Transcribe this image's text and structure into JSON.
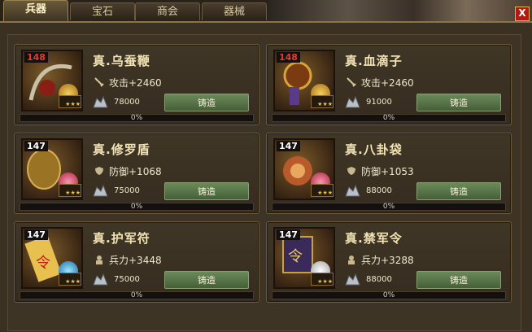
{
  "tabs": [
    {
      "label": "兵器",
      "active": true
    },
    {
      "label": "宝石",
      "active": false
    },
    {
      "label": "商会",
      "active": false
    },
    {
      "label": "器械",
      "active": false
    }
  ],
  "close_label": "X",
  "items": [
    {
      "level": "148",
      "name": "真.乌蚕鞭",
      "stat": "攻击+2460",
      "stat_icon": "sword-icon",
      "cost": "78000",
      "forge_label": "铸造",
      "progress": "0%",
      "level_color": "#e83a2a",
      "gem_color": "#d8a020"
    },
    {
      "level": "148",
      "name": "真.血滴子",
      "stat": "攻击+2460",
      "stat_icon": "sword-icon",
      "cost": "91000",
      "forge_label": "铸造",
      "progress": "0%",
      "level_color": "#e83a2a",
      "gem_color": "#d8a020"
    },
    {
      "level": "147",
      "name": "真.修罗盾",
      "stat": "防御+1068",
      "stat_icon": "shield-icon",
      "cost": "75000",
      "forge_label": "铸造",
      "progress": "0%",
      "level_color": "#ffffff",
      "gem_color": "#d84a6a"
    },
    {
      "level": "147",
      "name": "真.八卦袋",
      "stat": "防御+1053",
      "stat_icon": "shield-icon",
      "cost": "88000",
      "forge_label": "铸造",
      "progress": "0%",
      "level_color": "#ffffff",
      "gem_color": "#d84a6a"
    },
    {
      "level": "147",
      "name": "真.护军符",
      "stat": "兵力+3448",
      "stat_icon": "soldier-icon",
      "cost": "75000",
      "forge_label": "铸造",
      "progress": "0%",
      "level_color": "#ffffff",
      "gem_color": "#2aa6d8"
    },
    {
      "level": "147",
      "name": "真.禁军令",
      "stat": "兵力+3288",
      "stat_icon": "soldier-icon",
      "cost": "88000",
      "forge_label": "铸造",
      "progress": "0%",
      "level_color": "#ffffff",
      "gem_color": "#e8e8e8"
    }
  ]
}
